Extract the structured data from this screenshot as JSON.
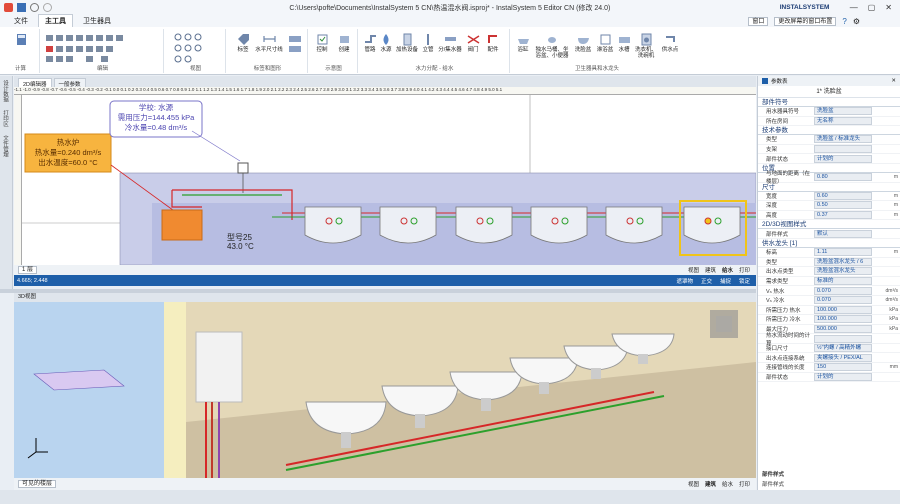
{
  "window": {
    "title": "C:\\Users\\pofte\\Documents\\InstalSystem 5 CN\\热温混水阀.isproj* - InstalSystem 5 Editor CN (修改 24.0)",
    "brand": "INSTALSYSTEM"
  },
  "menu": {
    "tabs": [
      "文件",
      "主工具",
      "卫生器具"
    ],
    "dropdown_window": "窗口",
    "dropdown_layout": "更改屏幕的窗口布置"
  },
  "ribbon": {
    "group_labels": [
      "计算",
      "编辑",
      "视图",
      "标签和图形",
      "示意图",
      "水力分配 - 给水",
      "卫生器具和水龙头"
    ],
    "buttons": [
      "标签",
      "水平尺寸线",
      "控制",
      "创建",
      "管路",
      "水源",
      "加热设备",
      "立管",
      "分/集水器",
      "阀门",
      "配件",
      "浴缸",
      "独水马桶、坐浴盆、小便器",
      "洗脸盆",
      "淋浴盆",
      "水槽",
      "洗衣机、洗碗机",
      "供水点"
    ]
  },
  "left_strip": [
    "设计数据",
    "打印区",
    "文件管理"
  ],
  "doc_tabs": [
    "2D编辑器",
    "一般参数"
  ],
  "ruler": "-1.1 -1.0 -0.9 -0.8 -0.7 -0.6 -0.5 -0.4 -0.3 -0.2 -0.1 0.0 0.1 0.2 0.3 0.4 0.5 0.6 0.7 0.8 0.9 1.0 1.1 1.2 1.3 1.4 1.5 1.6 1.7 1.8 1.9 2.0 2.1 2.2 2.3 2.4 2.5 2.6 2.7 2.8 2.9 3.0 3.1 3.2 3.3 3.4 3.5 3.6 3.7 3.8 3.9 4.0 4.1 4.2 4.3 4.4 4.5 4.6 4.7 4.8 4.9 5.0 5.1",
  "annotations": {
    "source_line1": "学校: 水源",
    "source_line2": "需用压力=144.455 kPa",
    "source_line3": "冷水量=0.48 dm³/s",
    "heater_line1": "热水炉",
    "heater_line2": "热水量=0.240 dm³/s",
    "heater_line3": "出水温度=60.0 °C",
    "valve_line1": "型号25",
    "valve_line2": "43.0 °C"
  },
  "status2d": {
    "floor": "1 层",
    "views": [
      "视图",
      "建筑",
      "给水",
      "打印"
    ]
  },
  "bluebar": {
    "coords": "4.665; 2.448",
    "items": [
      "遮罩物",
      "正交",
      "捕捉",
      "锁定"
    ]
  },
  "view3d": {
    "tab": "3D视图",
    "floor_select": "可见的楼层",
    "views": [
      "视图",
      "建筑",
      "给水",
      "打印"
    ]
  },
  "panel": {
    "header": "参数表",
    "title": "1* 洗脸盆",
    "sections": [
      {
        "name": "部件符号",
        "rows": [
          {
            "k": "用水器具符号",
            "v": "洗脸盆",
            "u": ""
          },
          {
            "k": "所在房间",
            "v": "无名称",
            "u": ""
          }
        ]
      },
      {
        "name": "技术参数",
        "rows": [
          {
            "k": "类型",
            "v": "洗脸盆 / 标准龙头",
            "u": ""
          },
          {
            "k": "支架",
            "v": "",
            "u": ""
          },
          {
            "k": "部件状态",
            "v": "计划的",
            "u": ""
          }
        ]
      },
      {
        "name": "位置",
        "rows": [
          {
            "k": "与地面的距离（在楼层）",
            "v": "0.80",
            "u": "m"
          }
        ]
      },
      {
        "name": "尺寸",
        "rows": [
          {
            "k": "宽度",
            "v": "0.60",
            "u": "m"
          },
          {
            "k": "深度",
            "v": "0.50",
            "u": "m"
          },
          {
            "k": "高度",
            "v": "0.37",
            "u": "m"
          }
        ]
      },
      {
        "name": "2D/3D视图样式",
        "rows": [
          {
            "k": "部件样式",
            "v": "默认",
            "u": ""
          }
        ]
      },
      {
        "name": "供水龙头 [1]",
        "rows": [
          {
            "k": "标高",
            "v": "1.11",
            "u": "m"
          },
          {
            "k": "类型",
            "v": "洗脸盆混水龙头 / 6",
            "u": ""
          },
          {
            "k": "出水点类型",
            "v": "洗脸盆混水龙头",
            "u": ""
          },
          {
            "k": "需求类型",
            "v": "标准的",
            "u": ""
          },
          {
            "k": "Vₙ 热水",
            "v": "0.070",
            "u": "dm³/s"
          },
          {
            "k": "Vₙ 冷水",
            "v": "0.070",
            "u": "dm³/s"
          },
          {
            "k": "所需压力 热水",
            "v": "100.000",
            "u": "kPa"
          },
          {
            "k": "所需压力 冷水",
            "v": "100.000",
            "u": "kPa"
          },
          {
            "k": "最大压力",
            "v": "500.000",
            "u": "kPa"
          },
          {
            "k": "热水流动时间的计算",
            "v": "",
            "u": ""
          },
          {
            "k": "接口尺寸",
            "v": "½\"内螺 / 高精外螺",
            "u": ""
          },
          {
            "k": "出水点连接系统",
            "v": "夹螺接头 / PEX/AL",
            "u": ""
          },
          {
            "k": "连接管线的长度",
            "v": "150",
            "u": "mm"
          },
          {
            "k": "部件状态",
            "v": "计划的",
            "u": ""
          }
        ]
      }
    ],
    "bottom1": "部件样式",
    "bottom2": "部件样式"
  },
  "colors": {
    "accent": "#1e5fa9",
    "hot_pipe": "#d62728",
    "cold_pipe": "#2ca02c",
    "heater_fill": "#f59a3a",
    "selection": "#f0c419"
  }
}
